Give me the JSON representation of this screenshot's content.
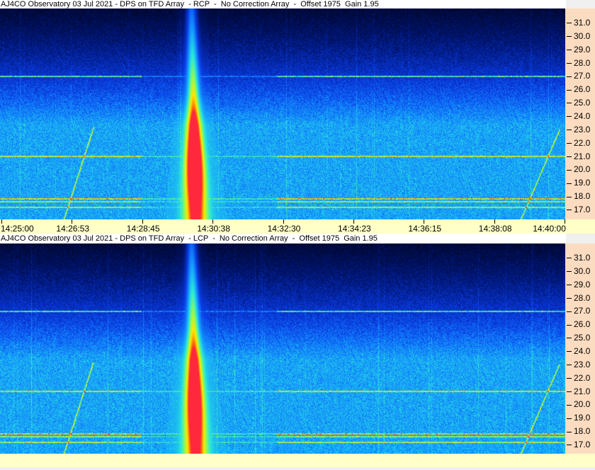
{
  "chart_data": [
    {
      "type": "heatmap",
      "title": "AJ4CO Observatory 03 Jul 2021 - DPS on TFD Array  - RCP  -  No Correction Array  -  Offset 1975  Gain 1.95",
      "polarization": "RCP",
      "xlabel": "",
      "ylabel": "",
      "x_ticks": [
        "14:25:00",
        "14:26:53",
        "14:28:45",
        "14:30:38",
        "14:32:30",
        "14:34:23",
        "14:36:15",
        "14:38:08",
        "14:40:00"
      ],
      "y_ticks": [
        "31.0",
        "30.0",
        "29.0",
        "28.0",
        "27.0",
        "26.0",
        "25.0",
        "24.0",
        "23.0",
        "22.0",
        "21.0",
        "20.0",
        "19.0",
        "18.0",
        "17.0"
      ],
      "ylim": [
        16.2,
        32.0
      ]
    },
    {
      "type": "heatmap",
      "title": "AJ4CO Observatory 03 Jul 2021 - DPS on TFD Array  - LCP  -  No Correction Array  -  Offset 1975  Gain 1.95",
      "polarization": "LCP",
      "xlabel": "",
      "ylabel": "",
      "x_ticks": [],
      "y_ticks": [
        "31.0",
        "30.0",
        "29.0",
        "28.0",
        "27.0",
        "26.0",
        "25.0",
        "24.0",
        "23.0",
        "22.0",
        "21.0",
        "20.0",
        "19.0",
        "18.0",
        "17.0"
      ],
      "ylim": [
        16.2,
        32.0
      ]
    }
  ]
}
